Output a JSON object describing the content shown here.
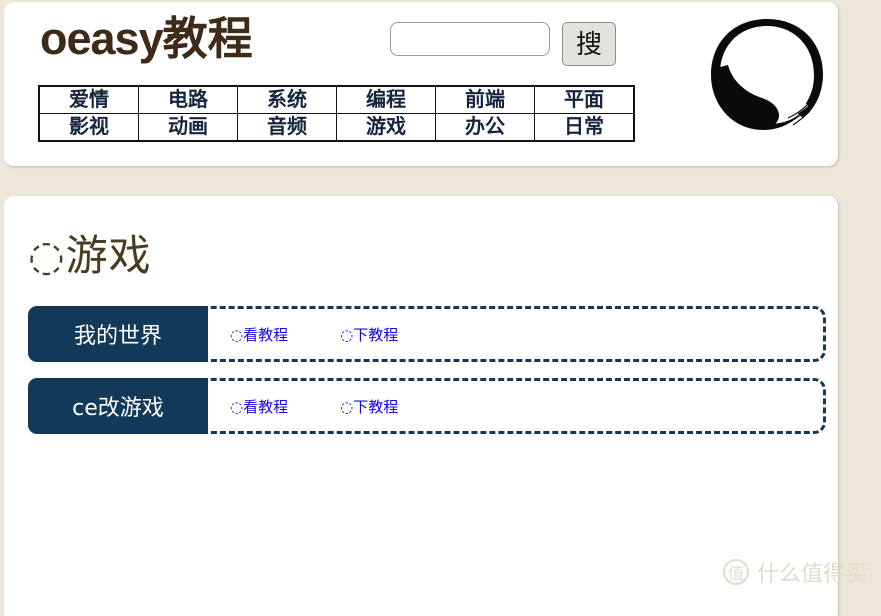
{
  "site": {
    "title_en": "oeasy",
    "title_cn": "教程"
  },
  "search": {
    "value": "",
    "placeholder": "",
    "button_label": "搜"
  },
  "logo": {
    "icon": "enso-circle-icon"
  },
  "nav": {
    "rows": [
      [
        {
          "label": "爱情"
        },
        {
          "label": "电路"
        },
        {
          "label": "系统"
        },
        {
          "label": "编程"
        },
        {
          "label": "前端"
        },
        {
          "label": "平面"
        }
      ],
      [
        {
          "label": "影视"
        },
        {
          "label": "动画"
        },
        {
          "label": "音频"
        },
        {
          "label": "游戏"
        },
        {
          "label": "办公"
        },
        {
          "label": "日常"
        }
      ]
    ]
  },
  "main": {
    "heading_glyph": "◌",
    "heading_text": "游戏",
    "rows": [
      {
        "label": "我的世界",
        "links": [
          {
            "glyph": "◌",
            "text": "看教程"
          },
          {
            "glyph": "◌",
            "text": "下教程"
          }
        ]
      },
      {
        "label": "ce改游戏",
        "links": [
          {
            "glyph": "◌",
            "text": "看教程"
          },
          {
            "glyph": "◌",
            "text": "下教程"
          }
        ]
      }
    ]
  },
  "watermark": {
    "badge": "值",
    "text": "什么值得买"
  },
  "colors": {
    "page_background": "#ece7d9",
    "card_background": "#ffffff",
    "title_brown": "#3d2a17",
    "nav_text": "#16243d",
    "accent_navy": "#123a58",
    "link_blue": "#1406f0",
    "watermark": "#e0dccb"
  }
}
